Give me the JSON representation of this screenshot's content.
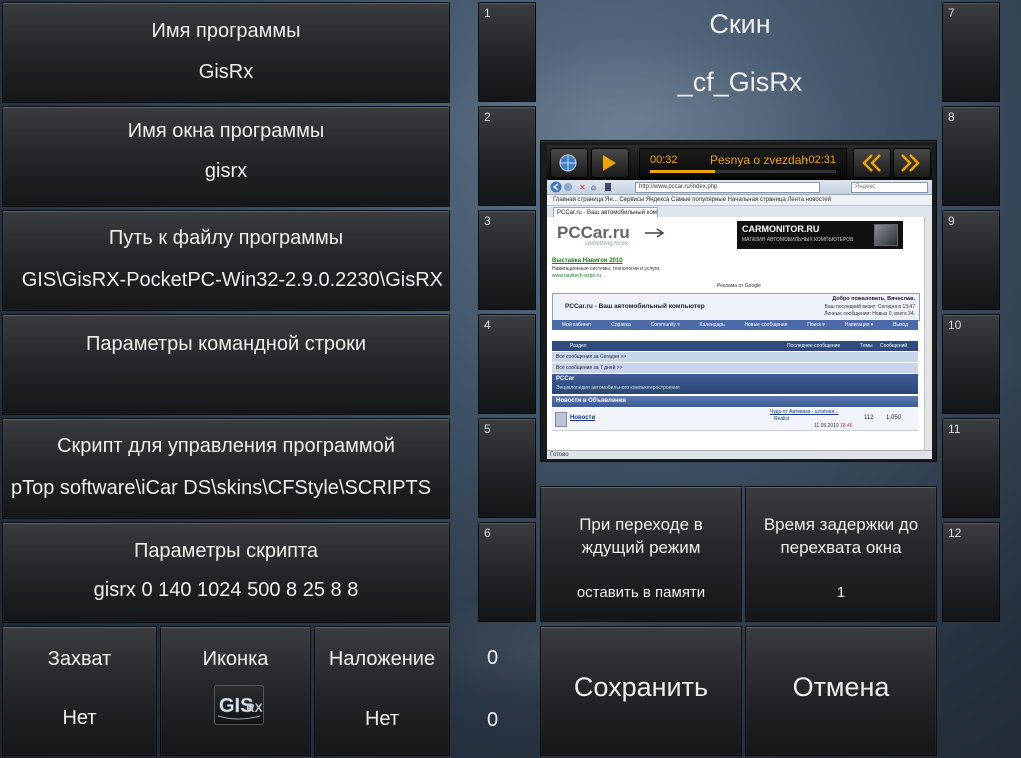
{
  "fields": {
    "program_name": {
      "label": "Имя программы",
      "value": "GisRx"
    },
    "window_name": {
      "label": "Имя окна программы",
      "value": "gisrx"
    },
    "program_path": {
      "label": "Путь к файлу программы",
      "value": "GIS\\GisRX-PocketPC-Win32-2.9.0.2230\\GisRX"
    },
    "cmd_params": {
      "label": "Параметры командной строки",
      "value": ""
    },
    "control_script": {
      "label": "Скрипт для управления программой",
      "value": "pTop software\\iCar DS\\skins\\CFStyle\\SCRIPTS"
    },
    "script_params": {
      "label": "Параметры скрипта",
      "value": "gisrx 0 140 1024 500 8 25 8 8"
    }
  },
  "bottom_left": {
    "capture": {
      "label": "Захват",
      "value": "Нет"
    },
    "icon": {
      "label": "Иконка",
      "icon_name": "gisrx-logo-icon"
    },
    "overlay": {
      "label": "Наложение",
      "value": "Нет"
    }
  },
  "counters": {
    "top": "0",
    "bottom": "0"
  },
  "skin": {
    "label": "Скин",
    "value": "_cf_GisRx"
  },
  "slots_left": [
    "1",
    "2",
    "3",
    "4",
    "5",
    "6"
  ],
  "slots_right": [
    "7",
    "8",
    "9",
    "10",
    "11",
    "12"
  ],
  "standby": {
    "label": "При переходе в ждущий режим",
    "value": "оставить в памяти"
  },
  "delay": {
    "label": "Время задержки до перехвата окна",
    "value": "1"
  },
  "actions": {
    "save": "Сохранить",
    "cancel": "Отмена"
  },
  "preview": {
    "player": {
      "time_elapsed": "00:32",
      "track": "Pesnya o zvezdah",
      "time_remaining": "-02:31",
      "progress": 0.35
    },
    "browser": {
      "url": "http://www.pccar.ru/index.php",
      "search": "Яндекс",
      "favorites": "Главная страница Ян...  Сервисы Яндекса  Самые популярные  Начальная страница  Лента новостей",
      "tab": "PCCar.ru - Ваш автомобильный ком...",
      "site_logo": "PCCar.ru",
      "site_slogan": "something more",
      "banner": "CARMONITOR.RU",
      "banner_sub": "МАГАЗИН АВТОМОБИЛЬНЫХ КОМПЬЮТЕРОВ",
      "ad_title": "Выставка Навигон 2010",
      "ad_line1": "Навигационные системы, технологии и услуги,",
      "ad_line2": "www.navitech-expo.ru",
      "google_note": "Реклама от Google",
      "page_title": "PCCar.ru - Ваш автомобильный компьютер",
      "welcome": "Добро пожаловать, Вячеслав.",
      "last_visit": "Ваш последний визит: Сегодня в 13:47",
      "messages": "Личные сообщения: Новых 0, всего 34.",
      "nav": [
        "Мой кабинет",
        "Справка",
        "Community ▾",
        "Календарь",
        "Новые сообщения",
        "Поиск ▾",
        "Навигация ▾",
        "Выход"
      ],
      "table_head": [
        "Раздел",
        "Последнее сообщение",
        "Темы",
        "Сообщений"
      ],
      "row1": "Все сообщения за Сегодня >>",
      "row2": "Все сообщения за 7 дней >>",
      "forum_name": "PCCar",
      "forum_desc": "Энциклопедия автомобильного компьютеростроения",
      "section": "Новости и Объявления",
      "news": "Новости",
      "news_last": "Чудо от Автоваза - штатная...",
      "news_author": "Realist",
      "news_date": "11.05.2010",
      "news_time": "18:46",
      "news_topics": "112",
      "news_posts": "1,050",
      "status": "Готово"
    }
  }
}
